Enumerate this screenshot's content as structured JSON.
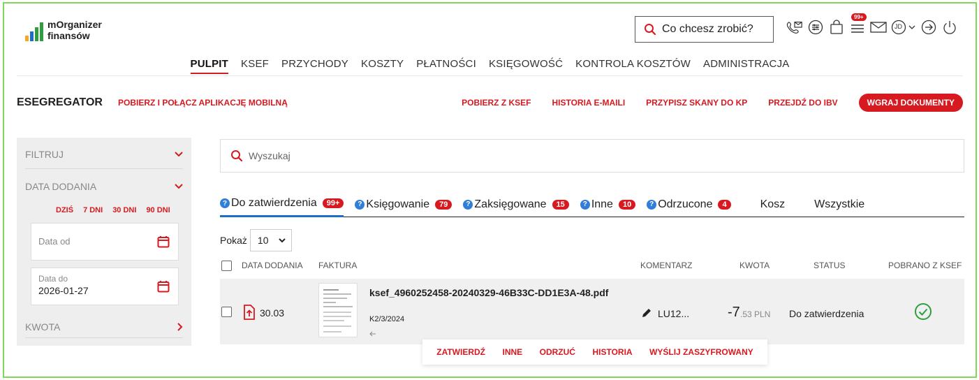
{
  "brand": {
    "line1": "mOrganizer",
    "line2": "finansów",
    "bar_colors": [
      "#f5a623",
      "#1e6ec8",
      "#2e9e3e",
      "#2e9e3e"
    ]
  },
  "header": {
    "search_placeholder": "Co chcesz zrobić?",
    "notification_count": "99+",
    "user_initials": "JD",
    "icons": [
      "phone-mail-icon",
      "sliders-icon",
      "bag-icon",
      "list-icon",
      "envelope-icon",
      "user-icon",
      "logout-icon",
      "power-icon"
    ]
  },
  "main_nav": [
    "PULPIT",
    "KSEF",
    "PRZYCHODY",
    "KOSZTY",
    "PŁATNOŚCI",
    "KSIĘGOWOŚĆ",
    "KONTROLA KOSZTÓW",
    "ADMINISTRACJA"
  ],
  "subbar": {
    "title": "ESEGREGATOR",
    "mobile_link": "POBIERZ I POŁĄCZ APLIKACJĘ MOBILNĄ",
    "links": [
      "POBIERZ Z KSEF",
      "HISTORIA E-MAILI",
      "PRZYPISZ SKANY DO KP",
      "PRZEJDŹ DO IBV"
    ],
    "upload_button": "WGRAJ DOKUMENTY"
  },
  "sidebar": {
    "filter": "FILTRUJ",
    "date_added": "DATA DODANIA",
    "quick_ranges": [
      "DZIŚ",
      "7 DNI",
      "30 DNI",
      "90 DNI"
    ],
    "date_from_placeholder": "Data od",
    "date_to_label": "Data do",
    "date_to_value": "2026-01-27",
    "amount": "KWOTA"
  },
  "main": {
    "search_placeholder": "Wyszukaj",
    "tabs": [
      {
        "label": "Do zatwierdzenia",
        "count": "99+"
      },
      {
        "label": "Księgowanie",
        "count": "79"
      },
      {
        "label": "Zaksięgowane",
        "count": "15"
      },
      {
        "label": "Inne",
        "count": "10"
      },
      {
        "label": "Odrzucone",
        "count": "4"
      },
      {
        "label": "Kosz"
      },
      {
        "label": "Wszystkie"
      }
    ],
    "show_label": "Pokaż",
    "show_value": "10",
    "columns": [
      "DATA DODANIA",
      "FAKTURA",
      "KOMENTARZ",
      "KWOTA",
      "STATUS",
      "POBRANO Z KSEF"
    ],
    "rows": [
      {
        "date": "30.03",
        "file_name": "ksef_4960252458-20240329-46B33C-DD1E3A-48.pdf",
        "doc_number": "K2/3/2024",
        "comment": "LU12...",
        "amount_main": "-7",
        "amount_rest": ".53 PLN",
        "status": "Do zatwierdzenia"
      }
    ],
    "row_actions": [
      "ZATWIERDŹ",
      "INNE",
      "ODRZUĆ",
      "HISTORIA",
      "WYŚLIJ ZASZYFROWANY"
    ]
  },
  "colors": {
    "accent_red": "#d71920",
    "tab_blue": "#1e6ec8",
    "frame_green": "#7ed957",
    "check_green": "#2e9e3e"
  }
}
